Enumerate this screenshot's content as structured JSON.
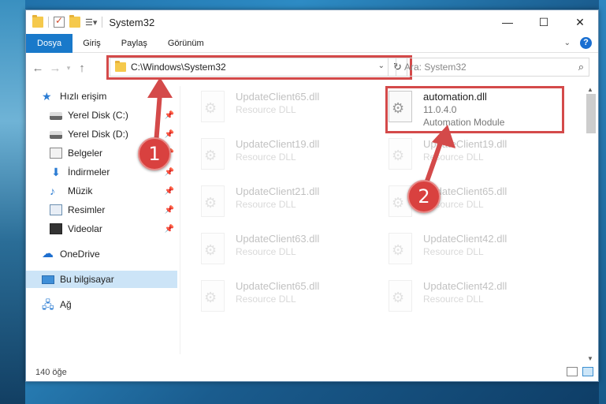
{
  "window": {
    "title": "System32",
    "controls": [
      "minimize-icon",
      "maximize-icon",
      "close-icon"
    ]
  },
  "ribbon": {
    "tabs": [
      "Dosya",
      "Giriş",
      "Paylaş",
      "Görünüm"
    ]
  },
  "address_bar": {
    "path": "C:\\Windows\\System32",
    "search_placeholder": "Ara: System32"
  },
  "nav_pane": {
    "items": [
      {
        "label": "Hızlı erişim",
        "icon": "star-icon"
      },
      {
        "label": "Yerel Disk (C:)",
        "icon": "drive-icon",
        "pinned": true
      },
      {
        "label": "Yerel Disk (D:)",
        "icon": "drive-icon",
        "pinned": true
      },
      {
        "label": "Belgeler",
        "icon": "documents-icon",
        "pinned": true
      },
      {
        "label": "İndirmeler",
        "icon": "download-icon",
        "pinned": true
      },
      {
        "label": "Müzik",
        "icon": "music-icon",
        "pinned": true
      },
      {
        "label": "Resimler",
        "icon": "pictures-icon",
        "pinned": true
      },
      {
        "label": "Videolar",
        "icon": "videos-icon",
        "pinned": true
      },
      {
        "label": "OneDrive",
        "icon": "cloud-icon"
      },
      {
        "label": "Bu bilgisayar",
        "icon": "computer-icon",
        "selected": true
      },
      {
        "label": "Ağ",
        "icon": "network-icon"
      }
    ]
  },
  "files": [
    {
      "name": "UpdateClient65.dll",
      "type": "Resource DLL"
    },
    {
      "name": "automation.dll",
      "version": "11.0.4.0",
      "type": "Automation Module"
    },
    {
      "name": "UpdateClient19.dll",
      "type": "Resource DLL"
    },
    {
      "name": "UpdateClient19.dll",
      "type": "Resource DLL"
    },
    {
      "name": "UpdateClient21.dll",
      "type": "Resource DLL"
    },
    {
      "name": "UpdateClient65.dll",
      "type": "Resource DLL"
    },
    {
      "name": "UpdateClient63.dll",
      "type": "Resource DLL"
    },
    {
      "name": "UpdateClient42.dll",
      "type": "Resource DLL"
    },
    {
      "name": "UpdateClient65.dll",
      "type": "Resource DLL"
    },
    {
      "name": "UpdateClient42.dll",
      "type": "Resource DLL"
    }
  ],
  "status": {
    "item_count": "140 öğe"
  },
  "annotations": {
    "step1": "1",
    "step2": "2",
    "color": "#d44a4a"
  }
}
